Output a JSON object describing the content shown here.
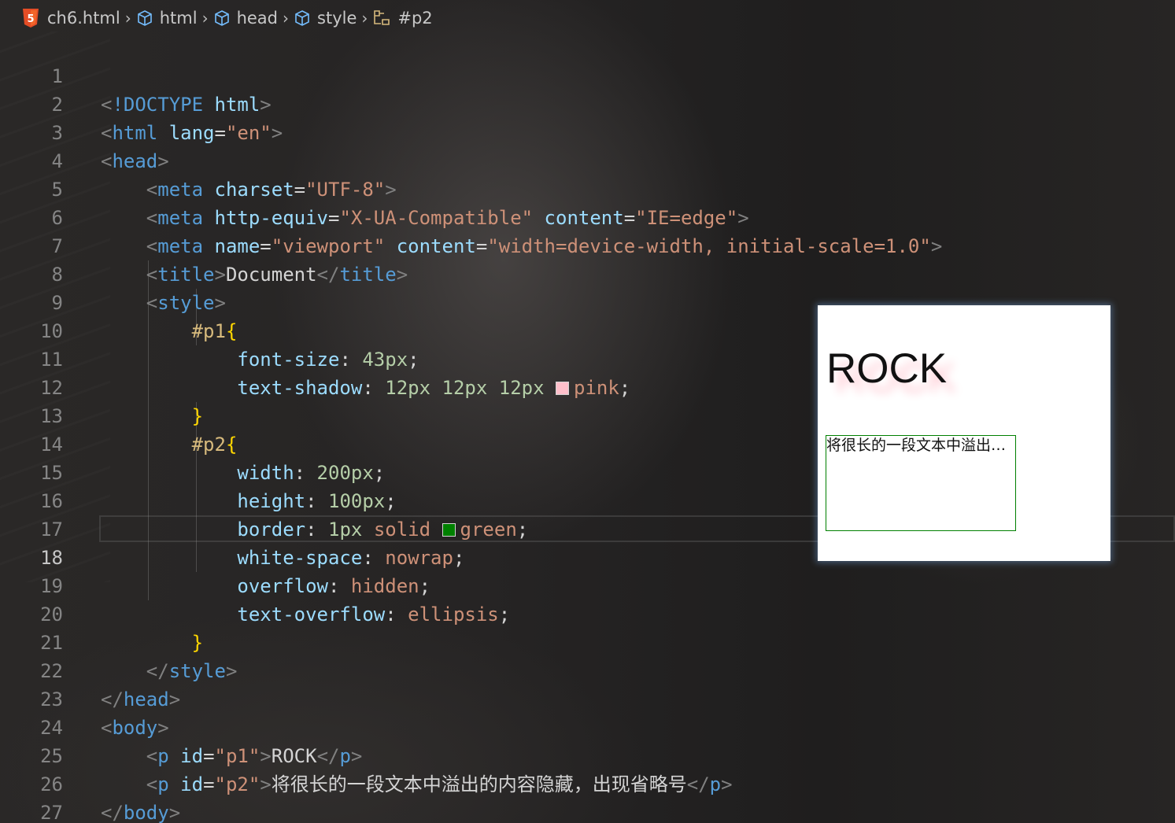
{
  "breadcrumb": {
    "file": "ch6.html",
    "html": "html",
    "head": "head",
    "style": "style",
    "selector": "#p2"
  },
  "colors": {
    "pink_swatch": "#ffc0cb",
    "green_swatch": "#008000"
  },
  "editor": {
    "active_line": "18",
    "lines": [
      {
        "n": "1"
      },
      {
        "n": "2"
      },
      {
        "n": "3"
      },
      {
        "n": "4"
      },
      {
        "n": "5"
      },
      {
        "n": "6"
      },
      {
        "n": "7"
      },
      {
        "n": "8"
      },
      {
        "n": "9"
      },
      {
        "n": "10"
      },
      {
        "n": "11"
      },
      {
        "n": "12"
      },
      {
        "n": "13"
      },
      {
        "n": "14"
      },
      {
        "n": "15"
      },
      {
        "n": "16"
      },
      {
        "n": "17"
      },
      {
        "n": "18"
      },
      {
        "n": "19"
      },
      {
        "n": "20"
      },
      {
        "n": "21"
      },
      {
        "n": "22"
      },
      {
        "n": "23"
      },
      {
        "n": "24"
      },
      {
        "n": "25"
      },
      {
        "n": "26"
      },
      {
        "n": "27"
      }
    ],
    "t": {
      "doctype": "!DOCTYPE",
      "html": "html",
      "lang": "lang",
      "en": "\"en\"",
      "head": "head",
      "meta": "meta",
      "charset": "charset",
      "utf8": "\"UTF-8\"",
      "http_equiv": "http-equiv",
      "xua": "\"X-UA-Compatible\"",
      "content": "content",
      "ie_edge": "\"IE=edge\"",
      "name": "name",
      "viewport": "\"viewport\"",
      "viewport_content": "\"width=device-width, initial-scale=1.0\"",
      "title": "title",
      "document": "Document",
      "style": "style",
      "p1_sel": "#p1",
      "p2_sel": "#p2",
      "font_size": "font-size",
      "v43px": "43px",
      "text_shadow": "text-shadow",
      "v12px": "12px",
      "pink": "pink",
      "width": "width",
      "v200px": "200px",
      "height": "height",
      "v100px": "100px",
      "border": "border",
      "v1px": "1px",
      "solid": "solid",
      "green": "green",
      "white_space": "white-space",
      "nowrap": "nowrap",
      "overflow": "overflow",
      "hidden": "hidden",
      "text_overflow": "text-overflow",
      "ellipsis": "ellipsis",
      "body": "body",
      "p": "p",
      "id": "id",
      "p1_str": "\"p1\"",
      "p2_str": "\"p2\"",
      "rock": "ROCK",
      "long_text": "将很长的一段文本中溢出的内容隐藏，出现省略号"
    }
  },
  "preview": {
    "p1_text": "ROCK",
    "p2_text": "将很长的一段文本中溢出的内容隐藏，出现省略号"
  }
}
